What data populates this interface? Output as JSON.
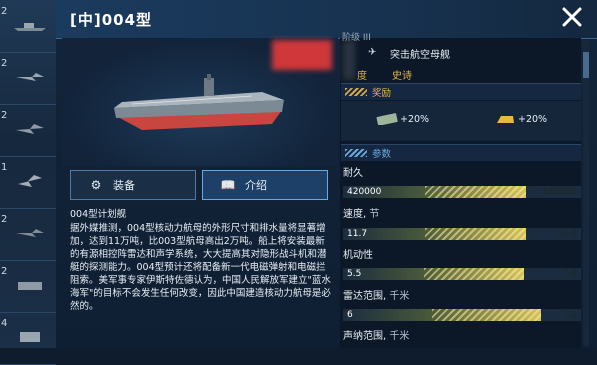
{
  "header": {
    "title": "[中]004型",
    "close_icon": "close-icon"
  },
  "sidebar": {
    "cards": [
      {
        "num": "2"
      },
      {
        "num": "2"
      },
      {
        "num": "2"
      },
      {
        "num": "1"
      },
      {
        "num": "2"
      },
      {
        "num": "2"
      },
      {
        "num": "4"
      }
    ]
  },
  "tabs": [
    {
      "icon": "gears-icon",
      "label": "装备"
    },
    {
      "icon": "book-icon",
      "label": "介绍"
    }
  ],
  "description": {
    "title": "004型计划舰",
    "body": "据外媒推测，004型核动力航母的外形尺寸和排水量将显著增加，达到11万吨，比003型航母高出2万吨。船上将安装最新的有源相控阵雷达和声学系统，大大提高其对隐形战斗机和潜艇的探测能力。004型预计还将配备新一代电磁弹射和电磁拦阻索。美军事专家伊斯特佐德认为，中国人民解放军建立\"蓝水海军\"的目标不会发生任何改变，因此中国建造核动力航母是必然的。"
  },
  "info": {
    "class_label": "阶级",
    "class_level": "III",
    "class_name": "突击航空母舰",
    "rarity_label": "度",
    "rarity": "史诗"
  },
  "reward": {
    "heading": "奖励",
    "items": [
      {
        "icon": "cash-icon",
        "value": "+20%"
      },
      {
        "icon": "gold-bar-icon",
        "value": "+20%"
      }
    ]
  },
  "params": {
    "heading": "参数",
    "stats": [
      {
        "label": "耐久",
        "unit": "",
        "value": "420000",
        "max": "546000",
        "fraction": 0.77
      },
      {
        "label": "速度",
        "unit": "节",
        "value": "11.7",
        "max": "15.2",
        "fraction": 0.77
      },
      {
        "label": "机动性",
        "unit": "",
        "value": "5.5",
        "max": "7.2",
        "fraction": 0.76
      },
      {
        "label": "雷达范围",
        "unit": "千米",
        "value": "6",
        "max": "7.2",
        "fraction": 0.83
      },
      {
        "label": "声纳范围",
        "unit": "千米",
        "value": "",
        "max": "",
        "fraction": 0
      }
    ]
  },
  "colors": {
    "accent": "#6aa9e0",
    "gold": "#e3b54d",
    "panel": "#0f1f33"
  }
}
